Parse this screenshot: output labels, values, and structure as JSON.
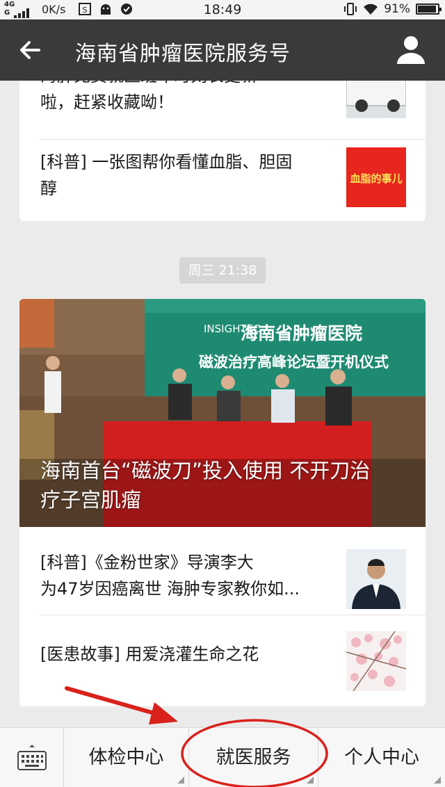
{
  "status_bar": {
    "network": "4G",
    "signal": "G",
    "speed": "0K/s",
    "time": "18:49",
    "battery": "91%"
  },
  "header": {
    "title": "海南省肿瘤医院服务号",
    "back_icon": "back-arrow-icon",
    "profile_icon": "person-icon"
  },
  "articles_top": [
    {
      "title": "海肿免费就医班车时刻表更新啦，赶紧收藏呦！",
      "line1": "海肿免费就医班车时刻表更新",
      "line2": "啦，赶紧收藏呦！"
    },
    {
      "title": "[科普] 一张图帮你看懂血脂、胆固醇",
      "line1": "[科普] 一张图帮你看懂血脂、胆固",
      "line2": "醇",
      "thumb_text": "血脂的事儿"
    }
  ],
  "timestamp": "周三 21:38",
  "hero_article": {
    "caption_line1": "海南首台“磁波刀”投入使用  不开刀治",
    "caption_line2": "疗子宫肌瘤",
    "banner_line1": "海南省肿瘤医院",
    "banner_line2": "磁波治疗高峰论坛暨开机仪式",
    "banner_logo": "INSIGHTEC"
  },
  "articles_bottom": [
    {
      "line1": "[科普]《金粉世家》导演李大",
      "line2": "为47岁因癌离世 海肿专家教你如..."
    },
    {
      "line1": "[医患故事] 用爱浇灌生命之花"
    }
  ],
  "bottom_menu": {
    "keyboard_icon": "keyboard-icon",
    "items": [
      {
        "label": "体检中心"
      },
      {
        "label": "就医服务"
      },
      {
        "label": "个人中心"
      }
    ]
  },
  "colors": {
    "header_bg": "#3a3a3a",
    "annotation_red": "#d9221c",
    "banner_green": "#1f8a72"
  }
}
